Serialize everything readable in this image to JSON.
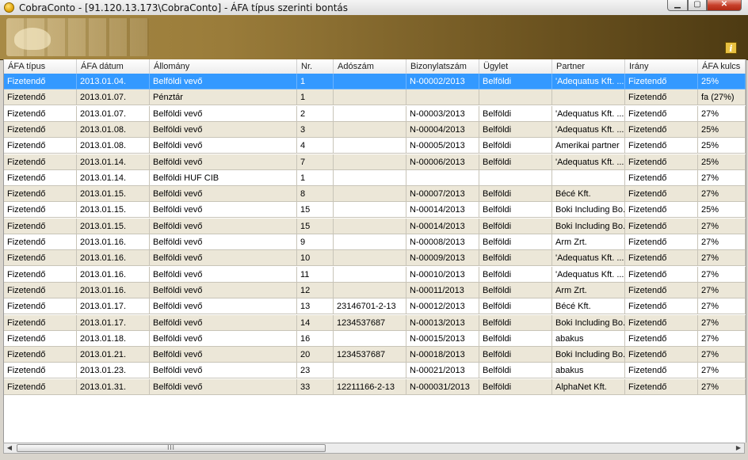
{
  "window": {
    "title": "CobraConto - [91.120.13.173\\CobraConto] - ÁFA típus szerinti bontás",
    "btn_min": "▁",
    "btn_max": "▢",
    "btn_close": "✕"
  },
  "banner": {
    "info_icon": "i"
  },
  "scrollbar": {
    "grip": "III",
    "left_arrow": "◀",
    "right_arrow": "▶"
  },
  "columns": [
    "ÁFA típus",
    "ÁFA dátum",
    "Állomány",
    "Nr.",
    "Adószám",
    "Bizonylatszám",
    "Ügylet",
    "Partner",
    "Irány",
    "ÁFA kulcs"
  ],
  "rows": [
    [
      "Fizetendő",
      "2013.01.04.",
      "Belföldi vevő",
      "1",
      "",
      "N-00002/2013",
      "Belföldi",
      "'Adequatus Kft. ...",
      "Fizetendő",
      "25%"
    ],
    [
      "Fizetendő",
      "2013.01.07.",
      "Pénztár",
      "1",
      "",
      "",
      "",
      "",
      "Fizetendő",
      "fa (27%)"
    ],
    [
      "Fizetendő",
      "2013.01.07.",
      "Belföldi vevő",
      "2",
      "",
      "N-00003/2013",
      "Belföldi",
      "'Adequatus Kft. ...",
      "Fizetendő",
      "27%"
    ],
    [
      "Fizetendő",
      "2013.01.08.",
      "Belföldi vevő",
      "3",
      "",
      "N-00004/2013",
      "Belföldi",
      "'Adequatus Kft. ...",
      "Fizetendő",
      "25%"
    ],
    [
      "Fizetendő",
      "2013.01.08.",
      "Belföldi vevő",
      "4",
      "",
      "N-00005/2013",
      "Belföldi",
      "Amerikai partner",
      "Fizetendő",
      "25%"
    ],
    [
      "Fizetendő",
      "2013.01.14.",
      "Belföldi vevő",
      "7",
      "",
      "N-00006/2013",
      "Belföldi",
      "'Adequatus Kft. ...",
      "Fizetendő",
      "25%"
    ],
    [
      "Fizetendő",
      "2013.01.14.",
      "Belföldi HUF CIB",
      "1",
      "",
      "",
      "",
      "",
      "Fizetendő",
      "27%"
    ],
    [
      "Fizetendő",
      "2013.01.15.",
      "Belföldi vevő",
      "8",
      "",
      "N-00007/2013",
      "Belföldi",
      "Bécé Kft.",
      "Fizetendő",
      "27%"
    ],
    [
      "Fizetendő",
      "2013.01.15.",
      "Belföldi vevő",
      "15",
      "",
      "N-00014/2013",
      "Belföldi",
      "Boki Including Bo...",
      "Fizetendő",
      "25%"
    ],
    [
      "Fizetendő",
      "2013.01.15.",
      "Belföldi vevő",
      "15",
      "",
      "N-00014/2013",
      "Belföldi",
      "Boki Including Bo...",
      "Fizetendő",
      "27%"
    ],
    [
      "Fizetendő",
      "2013.01.16.",
      "Belföldi vevő",
      "9",
      "",
      "N-00008/2013",
      "Belföldi",
      "Arm Zrt.",
      "Fizetendő",
      "27%"
    ],
    [
      "Fizetendő",
      "2013.01.16.",
      "Belföldi vevő",
      "10",
      "",
      "N-00009/2013",
      "Belföldi",
      "'Adequatus Kft. ...",
      "Fizetendő",
      "27%"
    ],
    [
      "Fizetendő",
      "2013.01.16.",
      "Belföldi vevő",
      "11",
      "",
      "N-00010/2013",
      "Belföldi",
      "'Adequatus Kft. ...",
      "Fizetendő",
      "27%"
    ],
    [
      "Fizetendő",
      "2013.01.16.",
      "Belföldi vevő",
      "12",
      "",
      "N-00011/2013",
      "Belföldi",
      "Arm Zrt.",
      "Fizetendő",
      "27%"
    ],
    [
      "Fizetendő",
      "2013.01.17.",
      "Belföldi vevő",
      "13",
      "23146701-2-13",
      "N-00012/2013",
      "Belföldi",
      "Bécé Kft.",
      "Fizetendő",
      "27%"
    ],
    [
      "Fizetendő",
      "2013.01.17.",
      "Belföldi vevő",
      "14",
      "1234537687",
      "N-00013/2013",
      "Belföldi",
      "Boki Including Bo...",
      "Fizetendő",
      "27%"
    ],
    [
      "Fizetendő",
      "2013.01.18.",
      "Belföldi vevő",
      "16",
      "",
      "N-00015/2013",
      "Belföldi",
      "abakus",
      "Fizetendő",
      "27%"
    ],
    [
      "Fizetendő",
      "2013.01.21.",
      "Belföldi vevő",
      "20",
      "1234537687",
      "N-00018/2013",
      "Belföldi",
      "Boki Including Bo...",
      "Fizetendő",
      "27%"
    ],
    [
      "Fizetendő",
      "2013.01.23.",
      "Belföldi vevő",
      "23",
      "",
      "N-00021/2013",
      "Belföldi",
      "abakus",
      "Fizetendő",
      "27%"
    ],
    [
      "Fizetendő",
      "2013.01.31.",
      "Belföldi vevő",
      "33",
      "12211166-2-13",
      "N-000031/2013",
      "Belföldi",
      "AlphaNet Kft.",
      "Fizetendő",
      "27%"
    ]
  ],
  "selected_row": 0
}
